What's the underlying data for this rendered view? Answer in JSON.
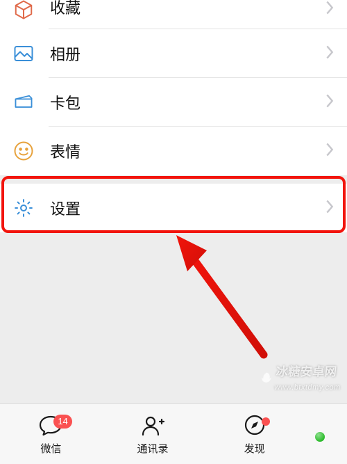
{
  "menu": {
    "favorites": {
      "label": "收藏"
    },
    "album": {
      "label": "相册"
    },
    "cards": {
      "label": "卡包"
    },
    "stickers": {
      "label": "表情"
    },
    "settings": {
      "label": "设置"
    }
  },
  "tabs": {
    "chats": {
      "label": "微信",
      "badge": "14"
    },
    "contacts": {
      "label": "通讯录"
    },
    "discover": {
      "label": "发现"
    }
  },
  "watermark": {
    "text": "冰糖安卓网",
    "url": "www.btxtdmy.com"
  }
}
